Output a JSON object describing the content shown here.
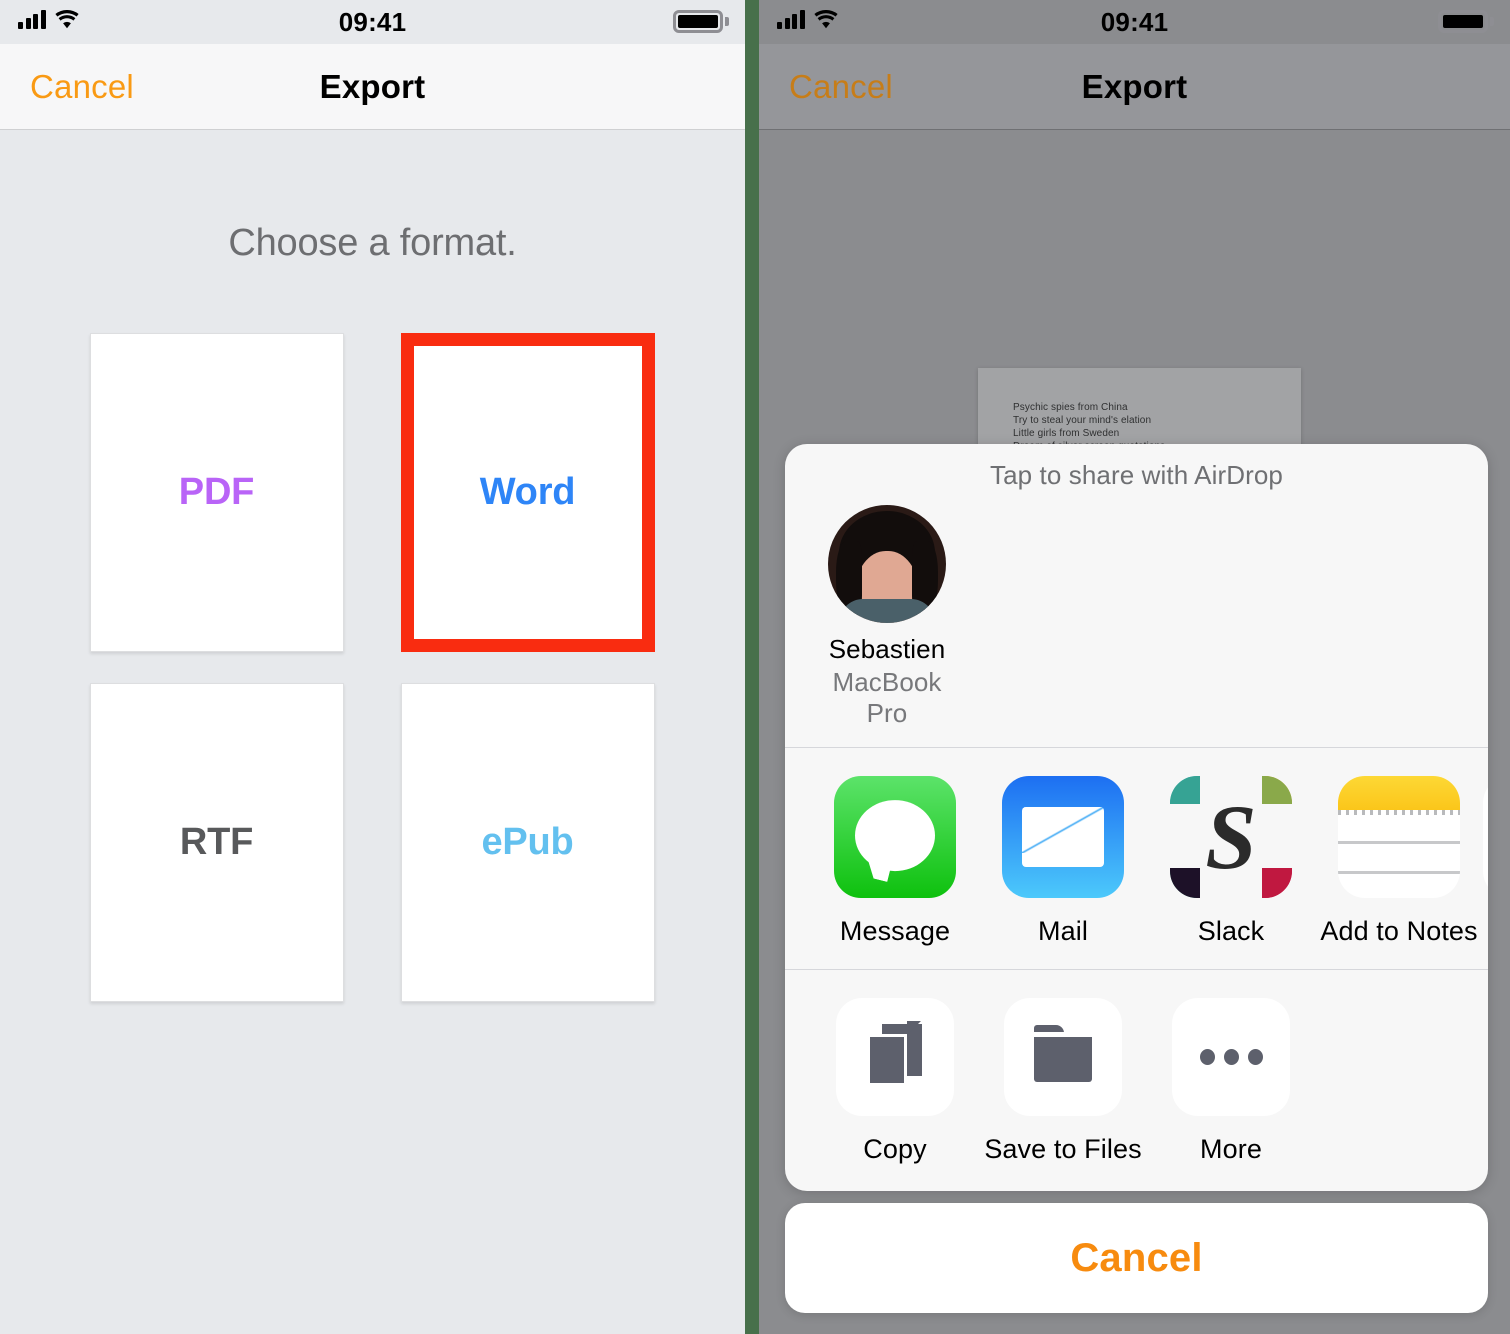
{
  "meta": {
    "colors": {
      "accent_orange": "#f99a14",
      "highlight_red": "#f92c10",
      "divider_green": "#47704b",
      "left_bg": "#e7e9ec",
      "dimmed_bg": "#8b8c8f",
      "pdf_purple": "#b964f7",
      "word_blue": "#2e85f7",
      "rtf_gray": "#58595b",
      "epub_blue": "#63c0ef"
    }
  },
  "left_panel": {
    "status_bar": {
      "time": "09:41",
      "signal_icon": "cellular-signal-icon",
      "wifi_icon": "wifi-icon",
      "battery_icon": "battery-full-icon"
    },
    "nav": {
      "cancel_label": "Cancel",
      "title": "Export"
    },
    "heading": "Choose a format.",
    "formats": [
      {
        "label": "PDF",
        "color": "#b964f7",
        "selected": false
      },
      {
        "label": "Word",
        "color": "#2e85f7",
        "selected": true
      },
      {
        "label": "RTF",
        "color": "#58595b",
        "selected": false
      },
      {
        "label": "ePub",
        "color": "#63c0ef",
        "selected": false
      }
    ]
  },
  "right_panel": {
    "status_bar": {
      "time": "09:41",
      "signal_icon": "cellular-signal-icon",
      "wifi_icon": "wifi-icon",
      "battery_icon": "battery-full-icon"
    },
    "nav": {
      "cancel_label": "Cancel",
      "title": "Export"
    },
    "document_preview": {
      "lines": [
        "Psychic spies from China",
        "Try to steal your mind's elation",
        "Little girls from Sweden",
        "Dream of silver screen quotations"
      ]
    },
    "share_sheet": {
      "airdrop": {
        "title": "Tap to share with AirDrop",
        "people": [
          {
            "name": "Sebastien",
            "device": "MacBook Pro",
            "avatar": "user-avatar"
          }
        ]
      },
      "apps": [
        {
          "label": "Message",
          "icon": "messages-app-icon"
        },
        {
          "label": "Mail",
          "icon": "mail-app-icon"
        },
        {
          "label": "Slack",
          "icon": "slack-app-icon"
        },
        {
          "label": "Add to Notes",
          "icon": "notes-app-icon"
        }
      ],
      "actions": [
        {
          "label": "Copy",
          "icon": "copy-icon"
        },
        {
          "label": "Save to Files",
          "icon": "folder-icon"
        },
        {
          "label": "More",
          "icon": "ellipsis-icon"
        }
      ]
    },
    "cancel_button": "Cancel"
  }
}
